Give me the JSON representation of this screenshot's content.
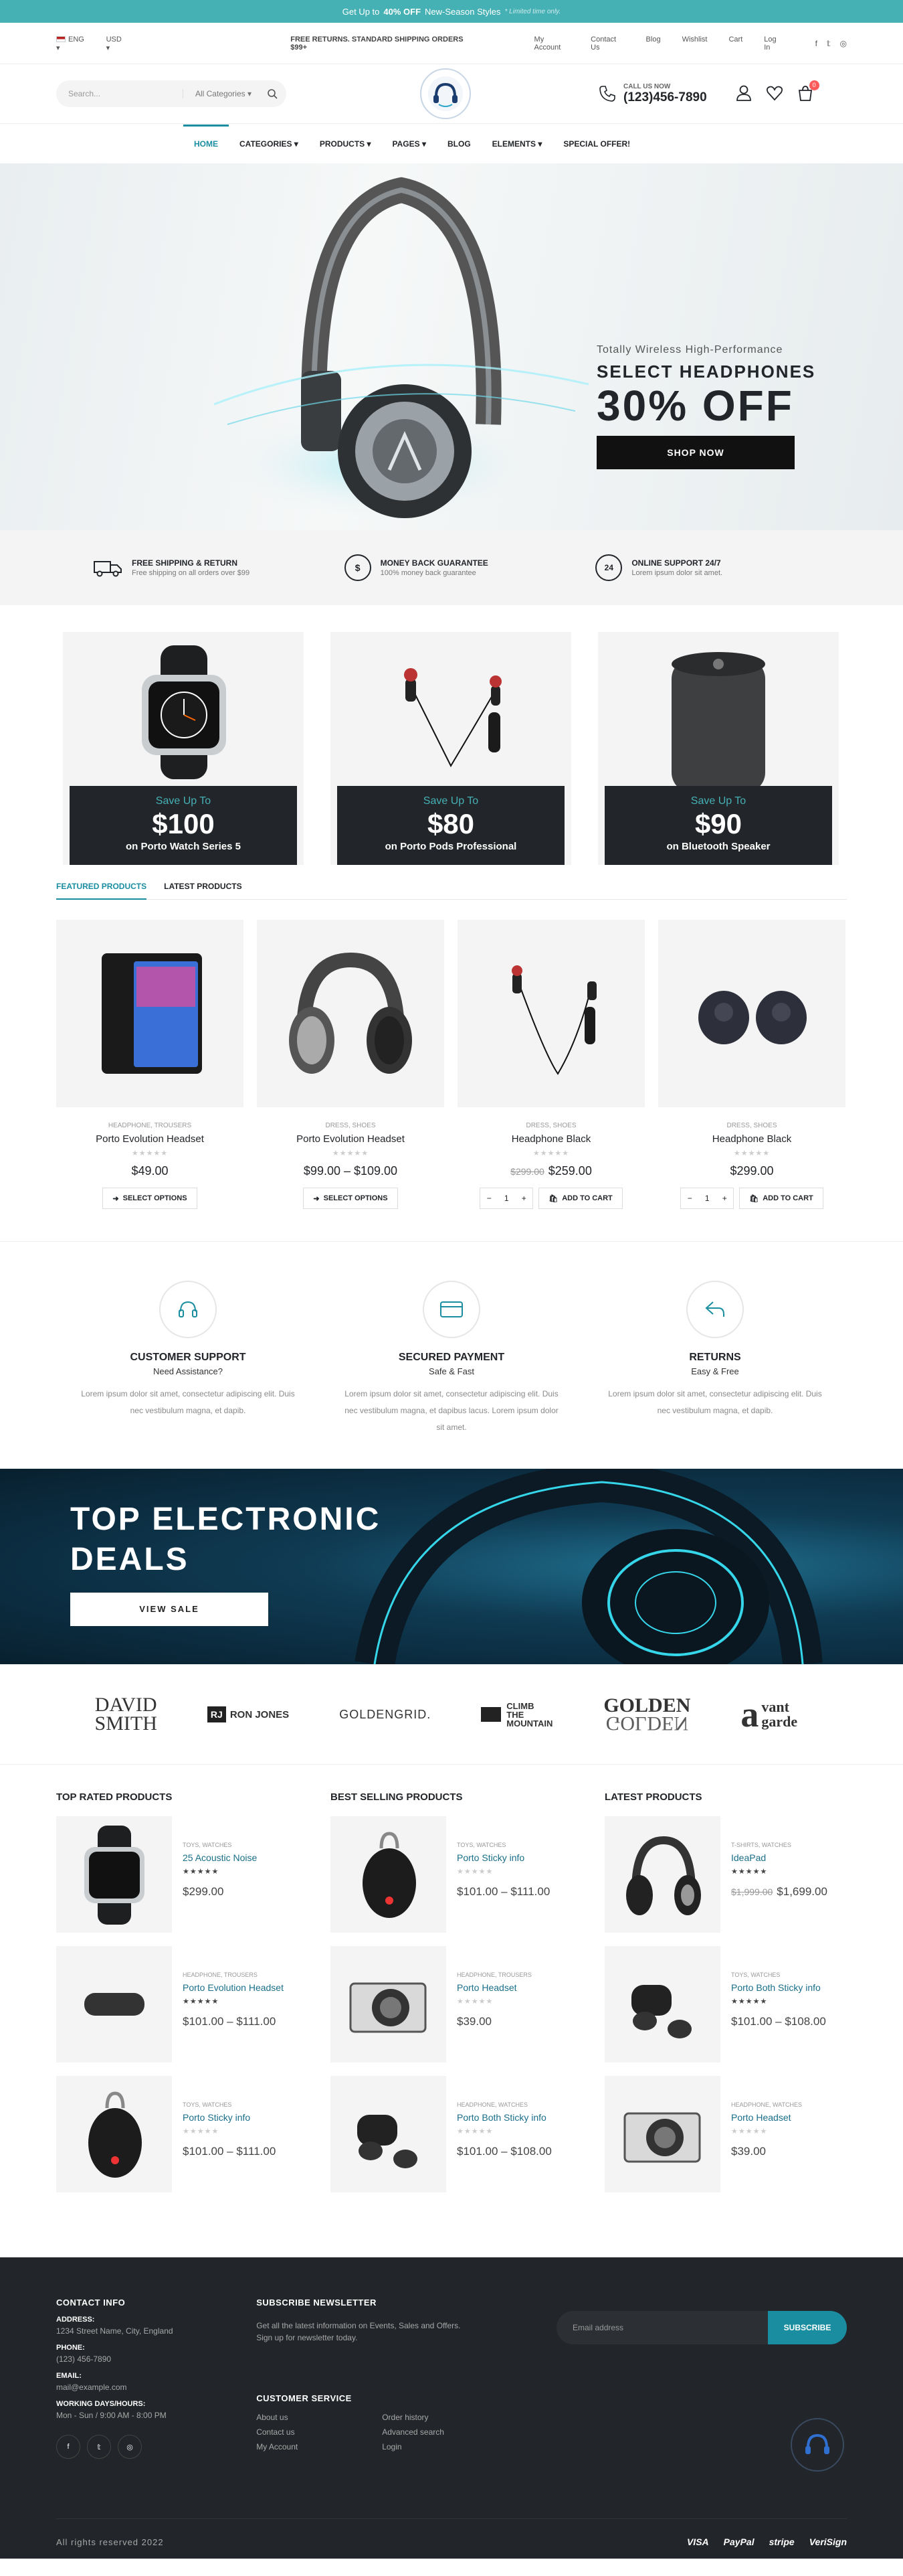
{
  "promo": {
    "pre": "Get Up to",
    "bold": "40% OFF",
    "post": "New-Season Styles",
    "note": "* Limited time only."
  },
  "topbar": {
    "lang": "ENG",
    "currency": "USD",
    "shipping": "FREE RETURNS. STANDARD SHIPPING ORDERS $99+",
    "links": [
      "My Account",
      "Contact Us",
      "Blog",
      "Wishlist",
      "Cart",
      "Log In"
    ]
  },
  "header": {
    "search_placeholder": "Search...",
    "category": "All Categories",
    "call_label": "CALL US NOW",
    "phone": "(123)456-7890",
    "cart_count": "0"
  },
  "nav": [
    "Home",
    "Categories",
    "Products",
    "Pages",
    "Blog",
    "Elements",
    "Special Offer!"
  ],
  "hero": {
    "subtitle": "Totally Wireless High-Performance",
    "title": "SELECT HEADPHONES",
    "discount": "30% OFF",
    "button": "SHOP NOW"
  },
  "info": [
    {
      "title": "FREE SHIPPING & RETURN",
      "desc": "Free shipping on all orders over $99",
      "icon": "truck-icon"
    },
    {
      "title": "MONEY BACK GUARANTEE",
      "desc": "100% money back guarantee",
      "icon": "dollar-icon"
    },
    {
      "title": "ONLINE SUPPORT 24/7",
      "desc": "Lorem ipsum dolor sit amet.",
      "icon": "support-icon"
    }
  ],
  "promos": [
    {
      "save": "Save Up To",
      "amount": "$100",
      "on": "on Porto Watch Series 5"
    },
    {
      "save": "Save Up To",
      "amount": "$80",
      "on": "on Porto Pods Professional"
    },
    {
      "save": "Save Up To",
      "amount": "$90",
      "on": "on Bluetooth Speaker"
    }
  ],
  "tabs": [
    "FEATURED PRODUCTS",
    "LATEST PRODUCTS"
  ],
  "products": [
    {
      "cat": "HEADPHONE, TROUSERS",
      "name": "Porto Evolution Headset",
      "price": "$49.00",
      "btn": "SELECT OPTIONS"
    },
    {
      "cat": "DRESS, SHOES",
      "name": "Porto Evolution Headset",
      "price": "$99.00 – $109.00",
      "btn": "SELECT OPTIONS"
    },
    {
      "cat": "DRESS, SHOES",
      "name": "Headphone Black",
      "old": "$299.00",
      "price": "$259.00",
      "btn": "ADD TO CART",
      "qty": "1"
    },
    {
      "cat": "DRESS, SHOES",
      "name": "Headphone Black",
      "price": "$299.00",
      "btn": "ADD TO CART",
      "qty": "1"
    }
  ],
  "features": [
    {
      "title": "CUSTOMER SUPPORT",
      "sub": "Need Assistance?",
      "text": "Lorem ipsum dolor sit amet, consectetur adipiscing elit. Duis nec vestibulum magna, et dapib."
    },
    {
      "title": "SECURED PAYMENT",
      "sub": "Safe & Fast",
      "text": "Lorem ipsum dolor sit amet, consectetur adipiscing elit. Duis nec vestibulum magna, et dapibus lacus. Lorem ipsum dolor sit amet."
    },
    {
      "title": "RETURNS",
      "sub": "Easy & Free",
      "text": "Lorem ipsum dolor sit amet, consectetur adipiscing elit. Duis nec vestibulum magna, et dapib."
    }
  ],
  "deals": {
    "line1": "TOP ELECTRONIC",
    "line2": "DEALS",
    "button": "VIEW SALE"
  },
  "brands": [
    {
      "a": "DAVID",
      "b": "SMITH"
    },
    {
      "a": "RJ",
      "b": "RON JONES"
    },
    {
      "a": "GOLDENGRID."
    },
    {
      "a": "CLIMB",
      "b": "THE MOUNTAIN"
    },
    {
      "a": "GOLDEN",
      "b": "GOLDEN"
    },
    {
      "a": "a",
      "b": "vant garde"
    }
  ],
  "lists": [
    {
      "title": "TOP RATED PRODUCTS",
      "items": [
        {
          "cat": "TOYS, WATCHES",
          "name": "25 Acoustic Noise",
          "price": "$299.00"
        },
        {
          "cat": "HEADPHONE, TROUSERS",
          "name": "Porto Evolution Headset",
          "price": "$101.00 – $111.00"
        },
        {
          "cat": "TOYS, WATCHES",
          "name": "Porto Sticky info",
          "price": "$101.00 – $111.00"
        }
      ]
    },
    {
      "title": "BEST SELLING PRODUCTS",
      "items": [
        {
          "cat": "TOYS, WATCHES",
          "name": "Porto Sticky info",
          "price": "$101.00 – $111.00"
        },
        {
          "cat": "HEADPHONE, TROUSERS",
          "name": "Porto Headset",
          "price": "$39.00"
        },
        {
          "cat": "HEADPHONE, WATCHES",
          "name": "Porto Both Sticky info",
          "price": "$101.00 – $108.00"
        }
      ]
    },
    {
      "title": "LATEST PRODUCTS",
      "items": [
        {
          "cat": "T-SHIRTS, WATCHES",
          "name": "IdeaPad",
          "old": "$1,999.00",
          "price": "$1,699.00"
        },
        {
          "cat": "TOYS, WATCHES",
          "name": "Porto Both Sticky info",
          "price": "$101.00 – $108.00"
        },
        {
          "cat": "HEADPHONE, WATCHES",
          "name": "Porto Headset",
          "price": "$39.00"
        }
      ]
    }
  ],
  "footer": {
    "contact_title": "CONTACT INFO",
    "address_label": "ADDRESS:",
    "address": "1234 Street Name, City, England",
    "phone_label": "PHONE:",
    "phone": "(123) 456-7890",
    "email_label": "EMAIL:",
    "email": "mail@example.com",
    "hours_label": "WORKING DAYS/HOURS:",
    "hours": "Mon - Sun / 9:00 AM - 8:00 PM",
    "newsletter_title": "SUBSCRIBE NEWSLETTER",
    "newsletter_text1": "Get all the latest information on Events, Sales and Offers.",
    "newsletter_text2": "Sign up for newsletter today.",
    "email_placeholder": "Email address",
    "subscribe": "SUBSCRIBE",
    "service_title": "CUSTOMER SERVICE",
    "service_links": [
      "About us",
      "Order history",
      "Contact us",
      "Advanced search",
      "My Account",
      "Login"
    ],
    "copyright": "All rights reserved 2022",
    "payments": [
      "VISA",
      "PayPal",
      "stripe",
      "VeriSign"
    ]
  }
}
